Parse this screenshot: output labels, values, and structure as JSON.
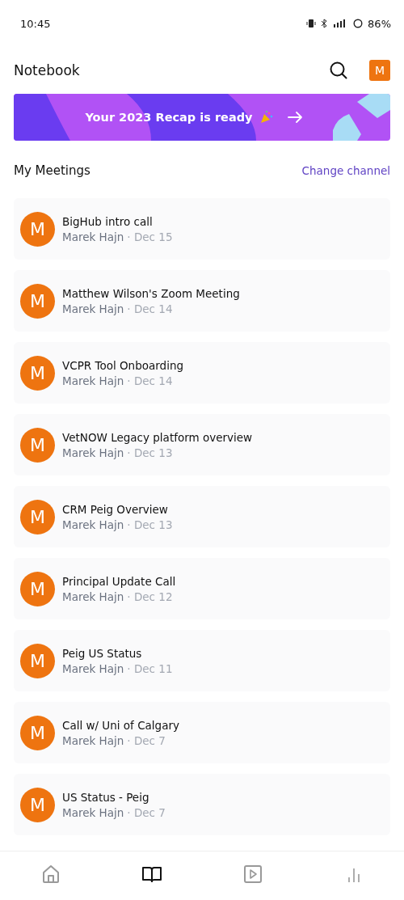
{
  "status_bar": {
    "time": "10:45",
    "battery": "86%"
  },
  "header": {
    "title": "Notebook",
    "avatar": "M"
  },
  "banner": {
    "text": "Your 2023 Recap is ready"
  },
  "section": {
    "title": "My Meetings",
    "action": "Change channel"
  },
  "separator": "·",
  "meetings": [
    {
      "avatar": "M",
      "title": "BigHub intro call",
      "owner": "Marek Hajn",
      "date": "Dec 15"
    },
    {
      "avatar": "M",
      "title": "Matthew Wilson's Zoom Meeting",
      "owner": "Marek Hajn",
      "date": "Dec 14"
    },
    {
      "avatar": "M",
      "title": "VCPR Tool Onboarding",
      "owner": "Marek Hajn",
      "date": "Dec 14"
    },
    {
      "avatar": "M",
      "title": "VetNOW Legacy platform overview",
      "owner": "Marek Hajn",
      "date": "Dec 13"
    },
    {
      "avatar": "M",
      "title": "CRM Peig Overview",
      "owner": "Marek Hajn",
      "date": "Dec 13"
    },
    {
      "avatar": "M",
      "title": "Principal Update Call",
      "owner": "Marek Hajn",
      "date": "Dec 12"
    },
    {
      "avatar": "M",
      "title": "Peig US Status",
      "owner": "Marek Hajn",
      "date": "Dec 11"
    },
    {
      "avatar": "M",
      "title": "Call w/ Uni of Calgary",
      "owner": "Marek Hajn",
      "date": "Dec 7"
    },
    {
      "avatar": "M",
      "title": "US Status - Peig",
      "owner": "Marek Hajn",
      "date": "Dec 7"
    }
  ],
  "nav": [
    {
      "kind": "home",
      "selected": false
    },
    {
      "kind": "book",
      "selected": true
    },
    {
      "kind": "play",
      "selected": false
    },
    {
      "kind": "stats",
      "selected": false
    }
  ]
}
